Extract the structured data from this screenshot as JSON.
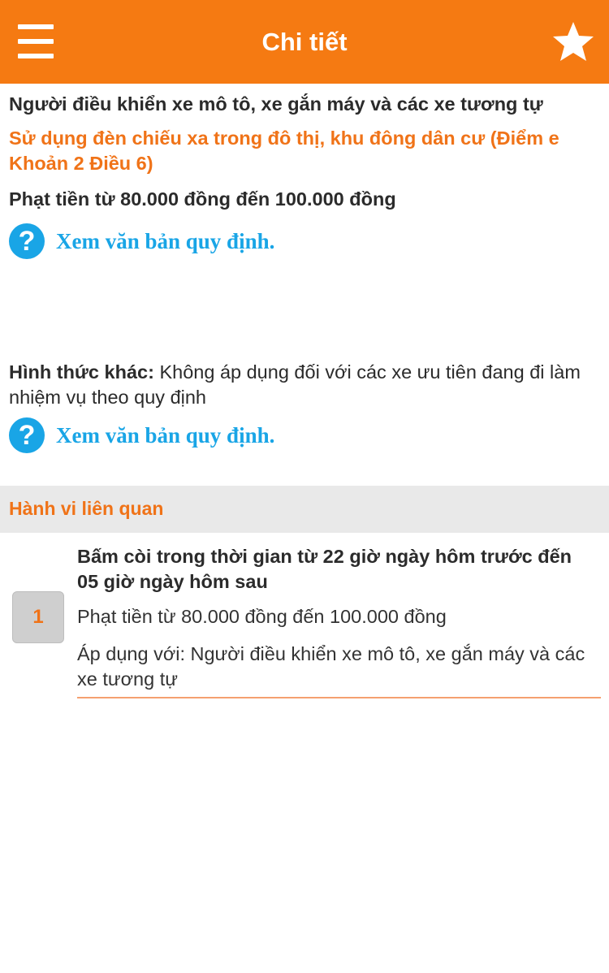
{
  "header": {
    "title": "Chi tiết",
    "menu_icon": "hamburger-menu-icon",
    "favorite_icon": "star-icon",
    "accent_color": "#f57a12"
  },
  "detail": {
    "subject": "Người điều khiển xe mô tô, xe gắn máy và các xe tương tự",
    "violation": "Sử dụng đèn chiếu xa trong đô thị, khu đông dân cư (Điểm e Khoản 2 Điều 6)",
    "fine": "Phạt tiền từ 80.000 đồng đến 100.000 đồng",
    "doc_link_label": "Xem văn bản quy định.",
    "other_label": "Hình thức khác:",
    "other_text": " Không áp dụng đối với các xe ưu tiên đang đi làm nhiệm vụ theo quy định",
    "doc_link_label_2": "Xem văn bản quy định.",
    "help_icon": "question-mark-icon",
    "help_icon_glyph": "?"
  },
  "related": {
    "title": "Hành vi liên quan",
    "items": [
      {
        "number": "1",
        "title": "Bấm còi trong thời gian từ 22 giờ ngày hôm trước đến 05 giờ ngày hôm sau",
        "fine": "Phạt tiền từ 80.000 đồng đến 100.000 đồng",
        "apply": "Áp dụng với: Người điều khiển xe mô tô, xe gắn máy và các xe tương tự"
      }
    ]
  }
}
